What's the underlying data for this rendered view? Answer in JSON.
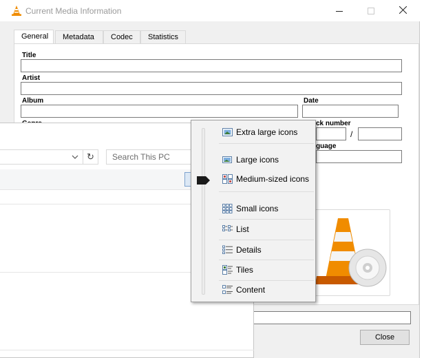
{
  "window": {
    "title": "Current Media Information",
    "icon": "vlc-cone-icon"
  },
  "tabs": [
    {
      "label": "General",
      "active": true
    },
    {
      "label": "Metadata",
      "active": false
    },
    {
      "label": "Codec",
      "active": false
    },
    {
      "label": "Statistics",
      "active": false
    }
  ],
  "general": {
    "title_label": "Title",
    "title_value": "",
    "artist_label": "Artist",
    "artist_value": "",
    "album_label": "Album",
    "album_value": "",
    "date_label": "Date",
    "date_value": "",
    "genre_label": "Genre",
    "track_label": "ck number",
    "track_sep": "/",
    "language_label": "guage"
  },
  "buttons": {
    "close": "Close"
  },
  "explorer": {
    "search_placeholder": "Search This PC",
    "refresh_icon": "refresh-icon"
  },
  "view_menu": {
    "items": [
      {
        "label": "Extra large icons",
        "icon": "extra-large-icons-icon"
      },
      {
        "label": "Large icons",
        "icon": "large-icons-icon"
      },
      {
        "label": "Medium-sized icons",
        "icon": "medium-icons-icon",
        "selected": true
      },
      {
        "label": "Small icons",
        "icon": "small-icons-icon"
      },
      {
        "label": "List",
        "icon": "list-view-icon"
      },
      {
        "label": "Details",
        "icon": "details-view-icon"
      },
      {
        "label": "Tiles",
        "icon": "tiles-view-icon"
      },
      {
        "label": "Content",
        "icon": "content-view-icon"
      }
    ]
  },
  "colors": {
    "vlc_orange": "#f08c00",
    "selection": "#dce8f5"
  }
}
